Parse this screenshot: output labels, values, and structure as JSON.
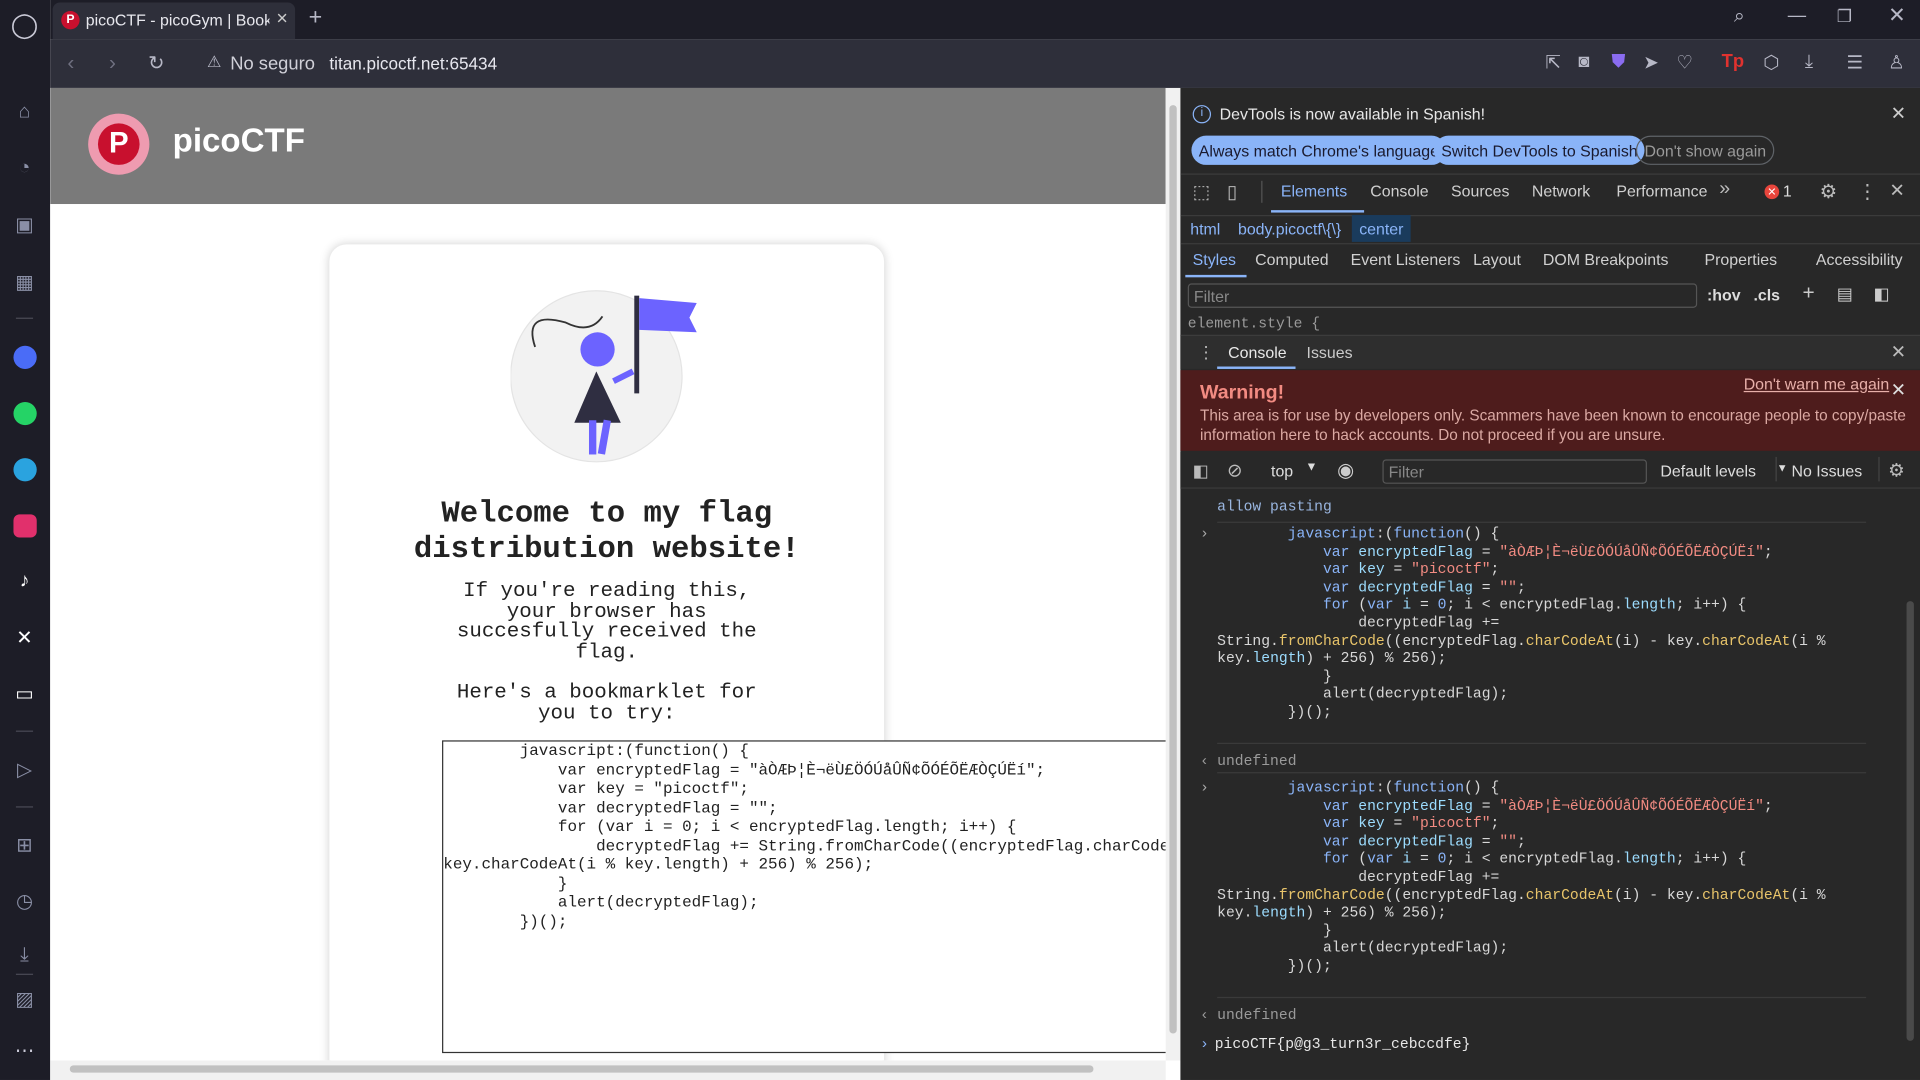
{
  "tab": {
    "title": "picoCTF - picoGym | Bookm"
  },
  "address": {
    "security": "No seguro",
    "url": "titan.picoctf.net:65434"
  },
  "page": {
    "brand": "picoCTF",
    "heading": [
      "Welcome to my flag",
      "distribution website!"
    ],
    "paragraph": [
      "If you're reading this,",
      "your browser has",
      "succesfully received the",
      "flag."
    ],
    "bookmarklet_intro": [
      "Here's a bookmarklet for",
      "you to try:"
    ],
    "code_lines": [
      "        javascript:(function() {",
      "            var encryptedFlag = \"àÒÆÞ¦È¬ëÙ£ÖÓÚåÛÑ¢ÕÓÉÕËÆÒÇÚËí\";",
      "            var key = \"picoctf\";",
      "            var decryptedFlag = \"\";",
      "            for (var i = 0; i < encryptedFlag.length; i++) {",
      "                decryptedFlag += String.fromCharCode((encryptedFlag.charCodeAt(i) -",
      "key.charCodeAt(i % key.length) + 256) % 256);",
      "            }",
      "            alert(decryptedFlag);",
      "        })();"
    ]
  },
  "devtools": {
    "notice": "DevTools is now available in Spanish!",
    "btn_match": "Always match Chrome's language",
    "btn_switch": "Switch DevTools to Spanish",
    "btn_dont": "Don't show again",
    "tabs": [
      "Elements",
      "Console",
      "Sources",
      "Network",
      "Performance"
    ],
    "error_count": "1",
    "breadcrumb": [
      "html",
      "body.picoctf\\{\\}",
      "center"
    ],
    "style_tabs": [
      "Styles",
      "Computed",
      "Event Listeners",
      "Layout",
      "DOM Breakpoints",
      "Properties",
      "Accessibility"
    ],
    "filter_placeholder": "Filter",
    "hov": ":hov",
    "cls": ".cls",
    "element_style": "element.style {",
    "drawer_tabs": [
      "Console",
      "Issues"
    ],
    "warning_title": "Warning!",
    "warning_dont": "Don't warn me again",
    "warning_text": [
      "This area is for use by developers only. Scammers have been known to encourage people to copy/paste",
      "information here to hack accounts. Do not proceed if you are unsure."
    ],
    "context": "top",
    "console_filter": "Filter",
    "levels": "Default levels",
    "issues": "No Issues",
    "allow_pasting": "allow pasting",
    "undefined": "undefined",
    "result": "picoCTF{p@g3_turn3r_cebccdfe}"
  }
}
